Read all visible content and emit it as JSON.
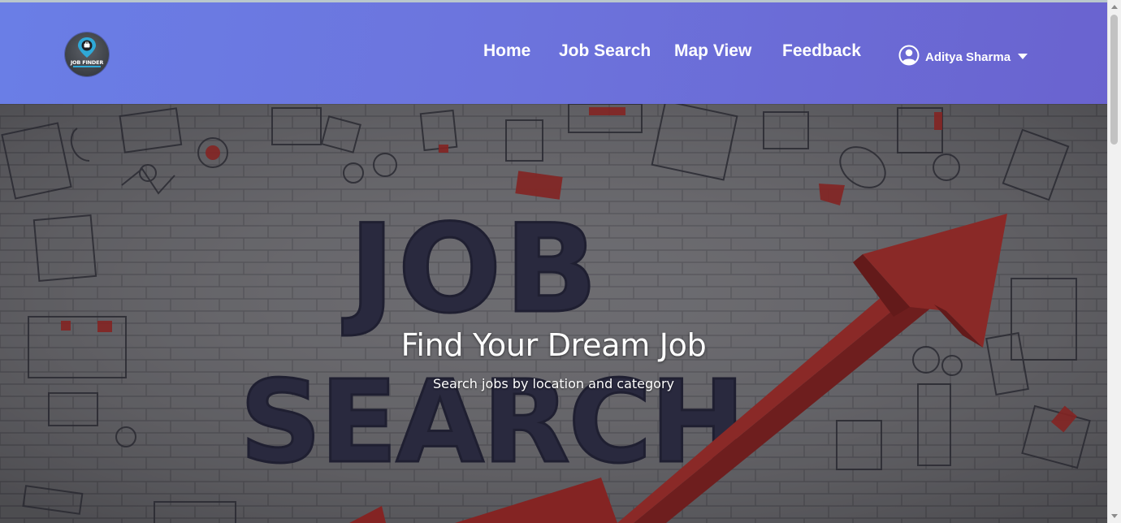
{
  "navbar": {
    "logo_text": "JOB FINDER",
    "links": [
      {
        "label": "Home"
      },
      {
        "label": "Job Search"
      },
      {
        "label": "Map View"
      },
      {
        "label": "Feedback"
      }
    ],
    "user": {
      "name": "Aditya Sharma",
      "icon": "user-circle-icon",
      "dropdown_icon": "caret-down-icon"
    }
  },
  "hero": {
    "title": "Find Your Dream Job",
    "subtitle": "Search jobs by location and category",
    "background_words": [
      "JOB",
      "SEARCH"
    ]
  },
  "colors": {
    "navbar_start": "#6a7ee6",
    "navbar_end": "#6a63cf",
    "hero_wall": "#77767a",
    "arrow_red": "#a8231f",
    "text_dark": "#2a2a45"
  }
}
